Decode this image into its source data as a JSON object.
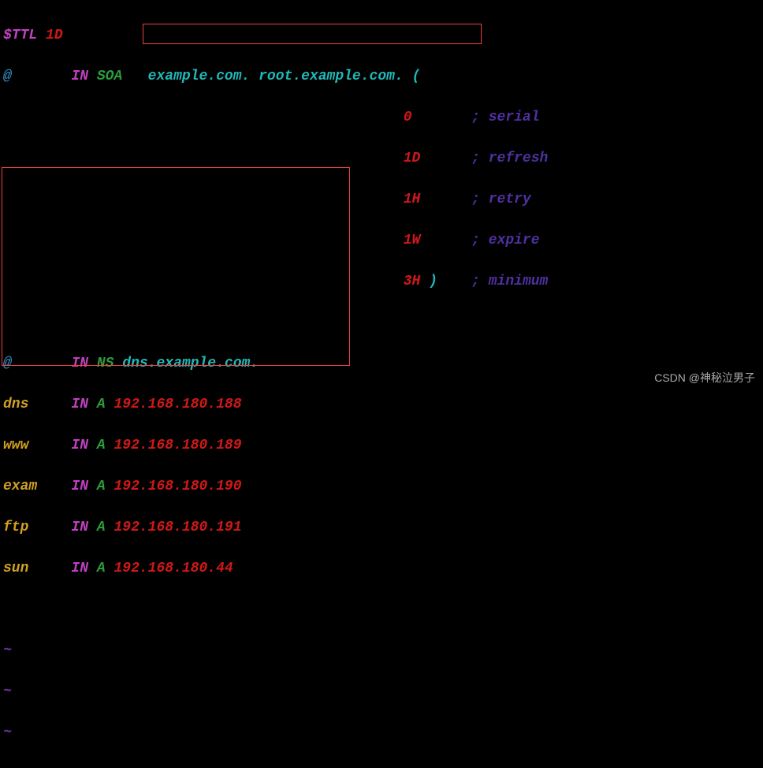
{
  "ttl": {
    "directive": "$TTL",
    "value": "1D"
  },
  "soa": {
    "origin": "@",
    "class": "IN",
    "type": "SOA",
    "mname": "example.com.",
    "rname": "root.example.com.",
    "open": "(",
    "close": ")",
    "params": [
      {
        "value": "0",
        "comment": "; serial"
      },
      {
        "value": "1D",
        "comment": "; refresh"
      },
      {
        "value": "1H",
        "comment": "; retry"
      },
      {
        "value": "1W",
        "comment": "; expire"
      },
      {
        "value": "3H",
        "comment": "; minimum"
      }
    ]
  },
  "records": [
    {
      "name": "@",
      "class": "IN",
      "type": "NS",
      "value": "dns.example.com."
    },
    {
      "name": "dns",
      "class": "IN",
      "type": "A",
      "value": "192.168.180.188"
    },
    {
      "name": "www",
      "class": "IN",
      "type": "A",
      "value": "192.168.180.189"
    },
    {
      "name": "exam",
      "class": "IN",
      "type": "A",
      "value": "192.168.180.190"
    },
    {
      "name": "ftp",
      "class": "IN",
      "type": "A",
      "value": "192.168.180.191"
    },
    {
      "name": "sun",
      "class": "IN",
      "type": "A",
      "value": "192.168.180.44"
    }
  ],
  "tildes": [
    "~",
    "~",
    "~"
  ],
  "watermark": "CSDN @神秘泣男子"
}
